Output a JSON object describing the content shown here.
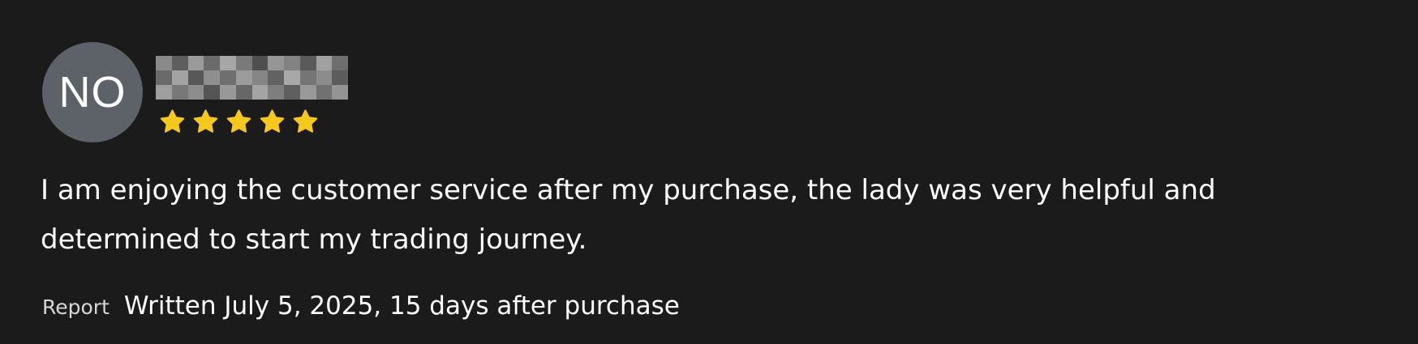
{
  "review": {
    "avatar_initials": "NO",
    "reviewer_name_redacted": true,
    "rating": 5,
    "max_rating": 5,
    "star_color": "#f6c81d",
    "body_lines": [
      "I am enjoying the customer service after my purchase, the lady was very helpful and",
      "determined to start my trading journey."
    ],
    "report_label": "Report",
    "written_label": "Written July 5, 2025, 15 days after purchase"
  },
  "colors": {
    "background": "#1b1b1b",
    "avatar_background": "#5d6168",
    "text": "#ffffff"
  },
  "icons": {
    "star": "star-icon"
  }
}
